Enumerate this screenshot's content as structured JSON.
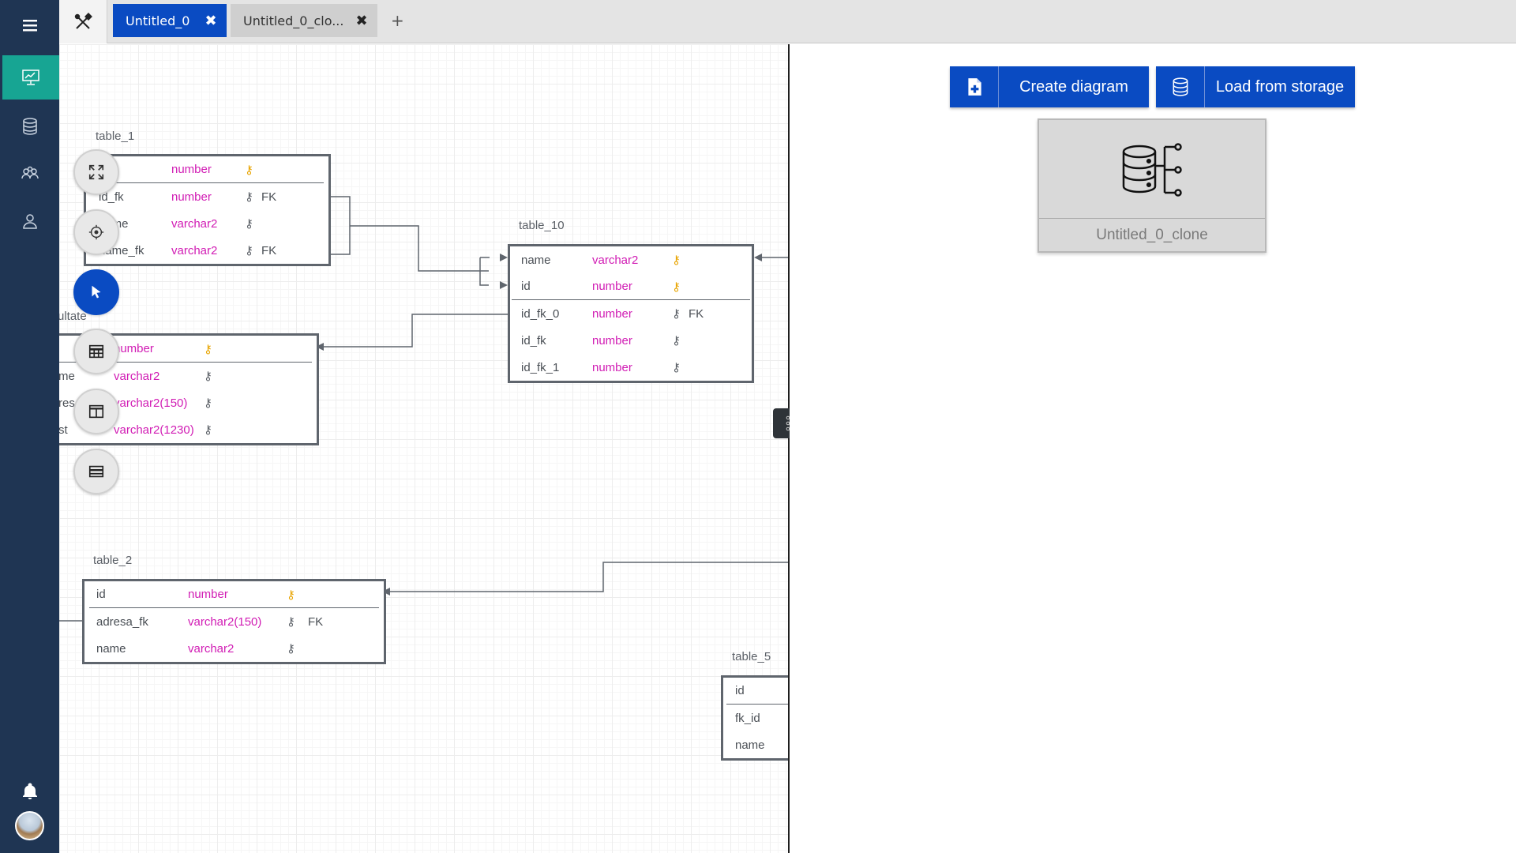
{
  "tabs": [
    {
      "label": "Untitled_0",
      "active": true
    },
    {
      "label": "Untitled_0_clo..."
    }
  ],
  "tab_add": "+",
  "tables": {
    "table_1": {
      "title": "table_1",
      "rows": [
        {
          "name": "",
          "type": "number",
          "pk": true,
          "fk": ""
        },
        {
          "name": "id_fk",
          "type": "number",
          "pk": false,
          "fk": "FK"
        },
        {
          "name": "name",
          "type": "varchar2",
          "pk": false,
          "fk": ""
        },
        {
          "name": "name_fk",
          "type": "varchar2",
          "pk": false,
          "fk": "FK"
        }
      ]
    },
    "table_10": {
      "title": "table_10",
      "rows": [
        {
          "name": "name",
          "type": "varchar2",
          "pk": true,
          "fk": ""
        },
        {
          "name": "id",
          "type": "number",
          "pk": true,
          "fk": ""
        },
        {
          "name": "id_fk_0",
          "type": "number",
          "pk": false,
          "fk": "FK"
        },
        {
          "name": "id_fk",
          "type": "number",
          "pk": false,
          "fk": ""
        },
        {
          "name": "id_fk_1",
          "type": "number",
          "pk": false,
          "fk": ""
        }
      ]
    },
    "rezultate": {
      "title": "ultate",
      "rows": [
        {
          "name": "",
          "type": "number",
          "pk": true,
          "fk": ""
        },
        {
          "name": "me",
          "type": "varchar2",
          "pk": false,
          "fk": ""
        },
        {
          "name": "res",
          "type": "varchar2(150)",
          "pk": false,
          "fk": ""
        },
        {
          "name": "st",
          "type": "varchar2(1230)",
          "pk": false,
          "fk": ""
        }
      ]
    },
    "table_2": {
      "title": "table_2",
      "rows": [
        {
          "name": "id",
          "type": "number",
          "pk": true,
          "fk": ""
        },
        {
          "name": "adresa_fk",
          "type": "varchar2(150)",
          "pk": false,
          "fk": "FK"
        },
        {
          "name": "name",
          "type": "varchar2",
          "pk": false,
          "fk": ""
        }
      ]
    },
    "table_5": {
      "title": "table_5",
      "rows": [
        {
          "name": "id"
        },
        {
          "name": "fk_id"
        },
        {
          "name": "name"
        }
      ]
    }
  },
  "buttons": {
    "create_diagram": "Create diagram",
    "load_from_storage": "Load from storage"
  },
  "card": {
    "label": "Untitled_0_clone"
  },
  "colors": {
    "sidebar": "#1f3553",
    "sidebar_active": "#17a593",
    "primary": "#0a4bc2",
    "type_text": "#d11cb4",
    "pk_key": "#e8a400"
  }
}
